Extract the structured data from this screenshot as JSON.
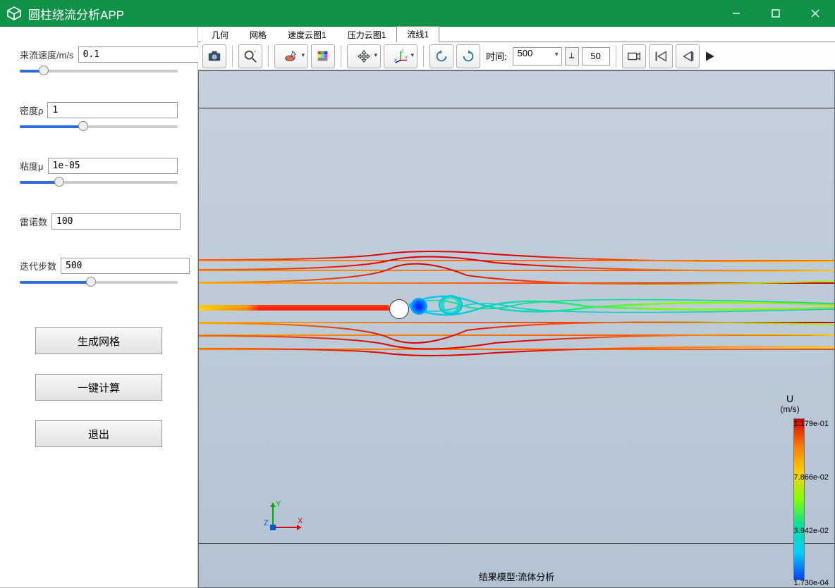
{
  "app": {
    "title": "圆柱绕流分析APP"
  },
  "sidebar": {
    "params": [
      {
        "label": "来流速度/m/s",
        "value": "0.1",
        "slider_pct": 15
      },
      {
        "label": "密度ρ",
        "value": "1",
        "slider_pct": 40
      },
      {
        "label": "粘度μ",
        "value": "1e-05",
        "slider_pct": 25
      },
      {
        "label": "雷诺数",
        "value": "100",
        "slider_pct": 0
      },
      {
        "label": "迭代步数",
        "value": "500",
        "slider_pct": 45
      }
    ],
    "buttons": {
      "mesh": "生成网格",
      "compute": "一键计算",
      "exit": "退出"
    }
  },
  "tabs": [
    {
      "label": "几何",
      "active": false
    },
    {
      "label": "网格",
      "active": false
    },
    {
      "label": "速度云图1",
      "active": false
    },
    {
      "label": "压力云图1",
      "active": false
    },
    {
      "label": "流线1",
      "active": true
    }
  ],
  "toolbar": {
    "time_label": "时间:",
    "time_value": "500",
    "step_value": "50"
  },
  "legend": {
    "title": "U",
    "unit": "(m/s)",
    "max": "1.179e-01",
    "mid1": "7.866e-02",
    "mid2": "3.942e-02",
    "min": "1.730e-04"
  },
  "footer": "结果模型:流体分析"
}
